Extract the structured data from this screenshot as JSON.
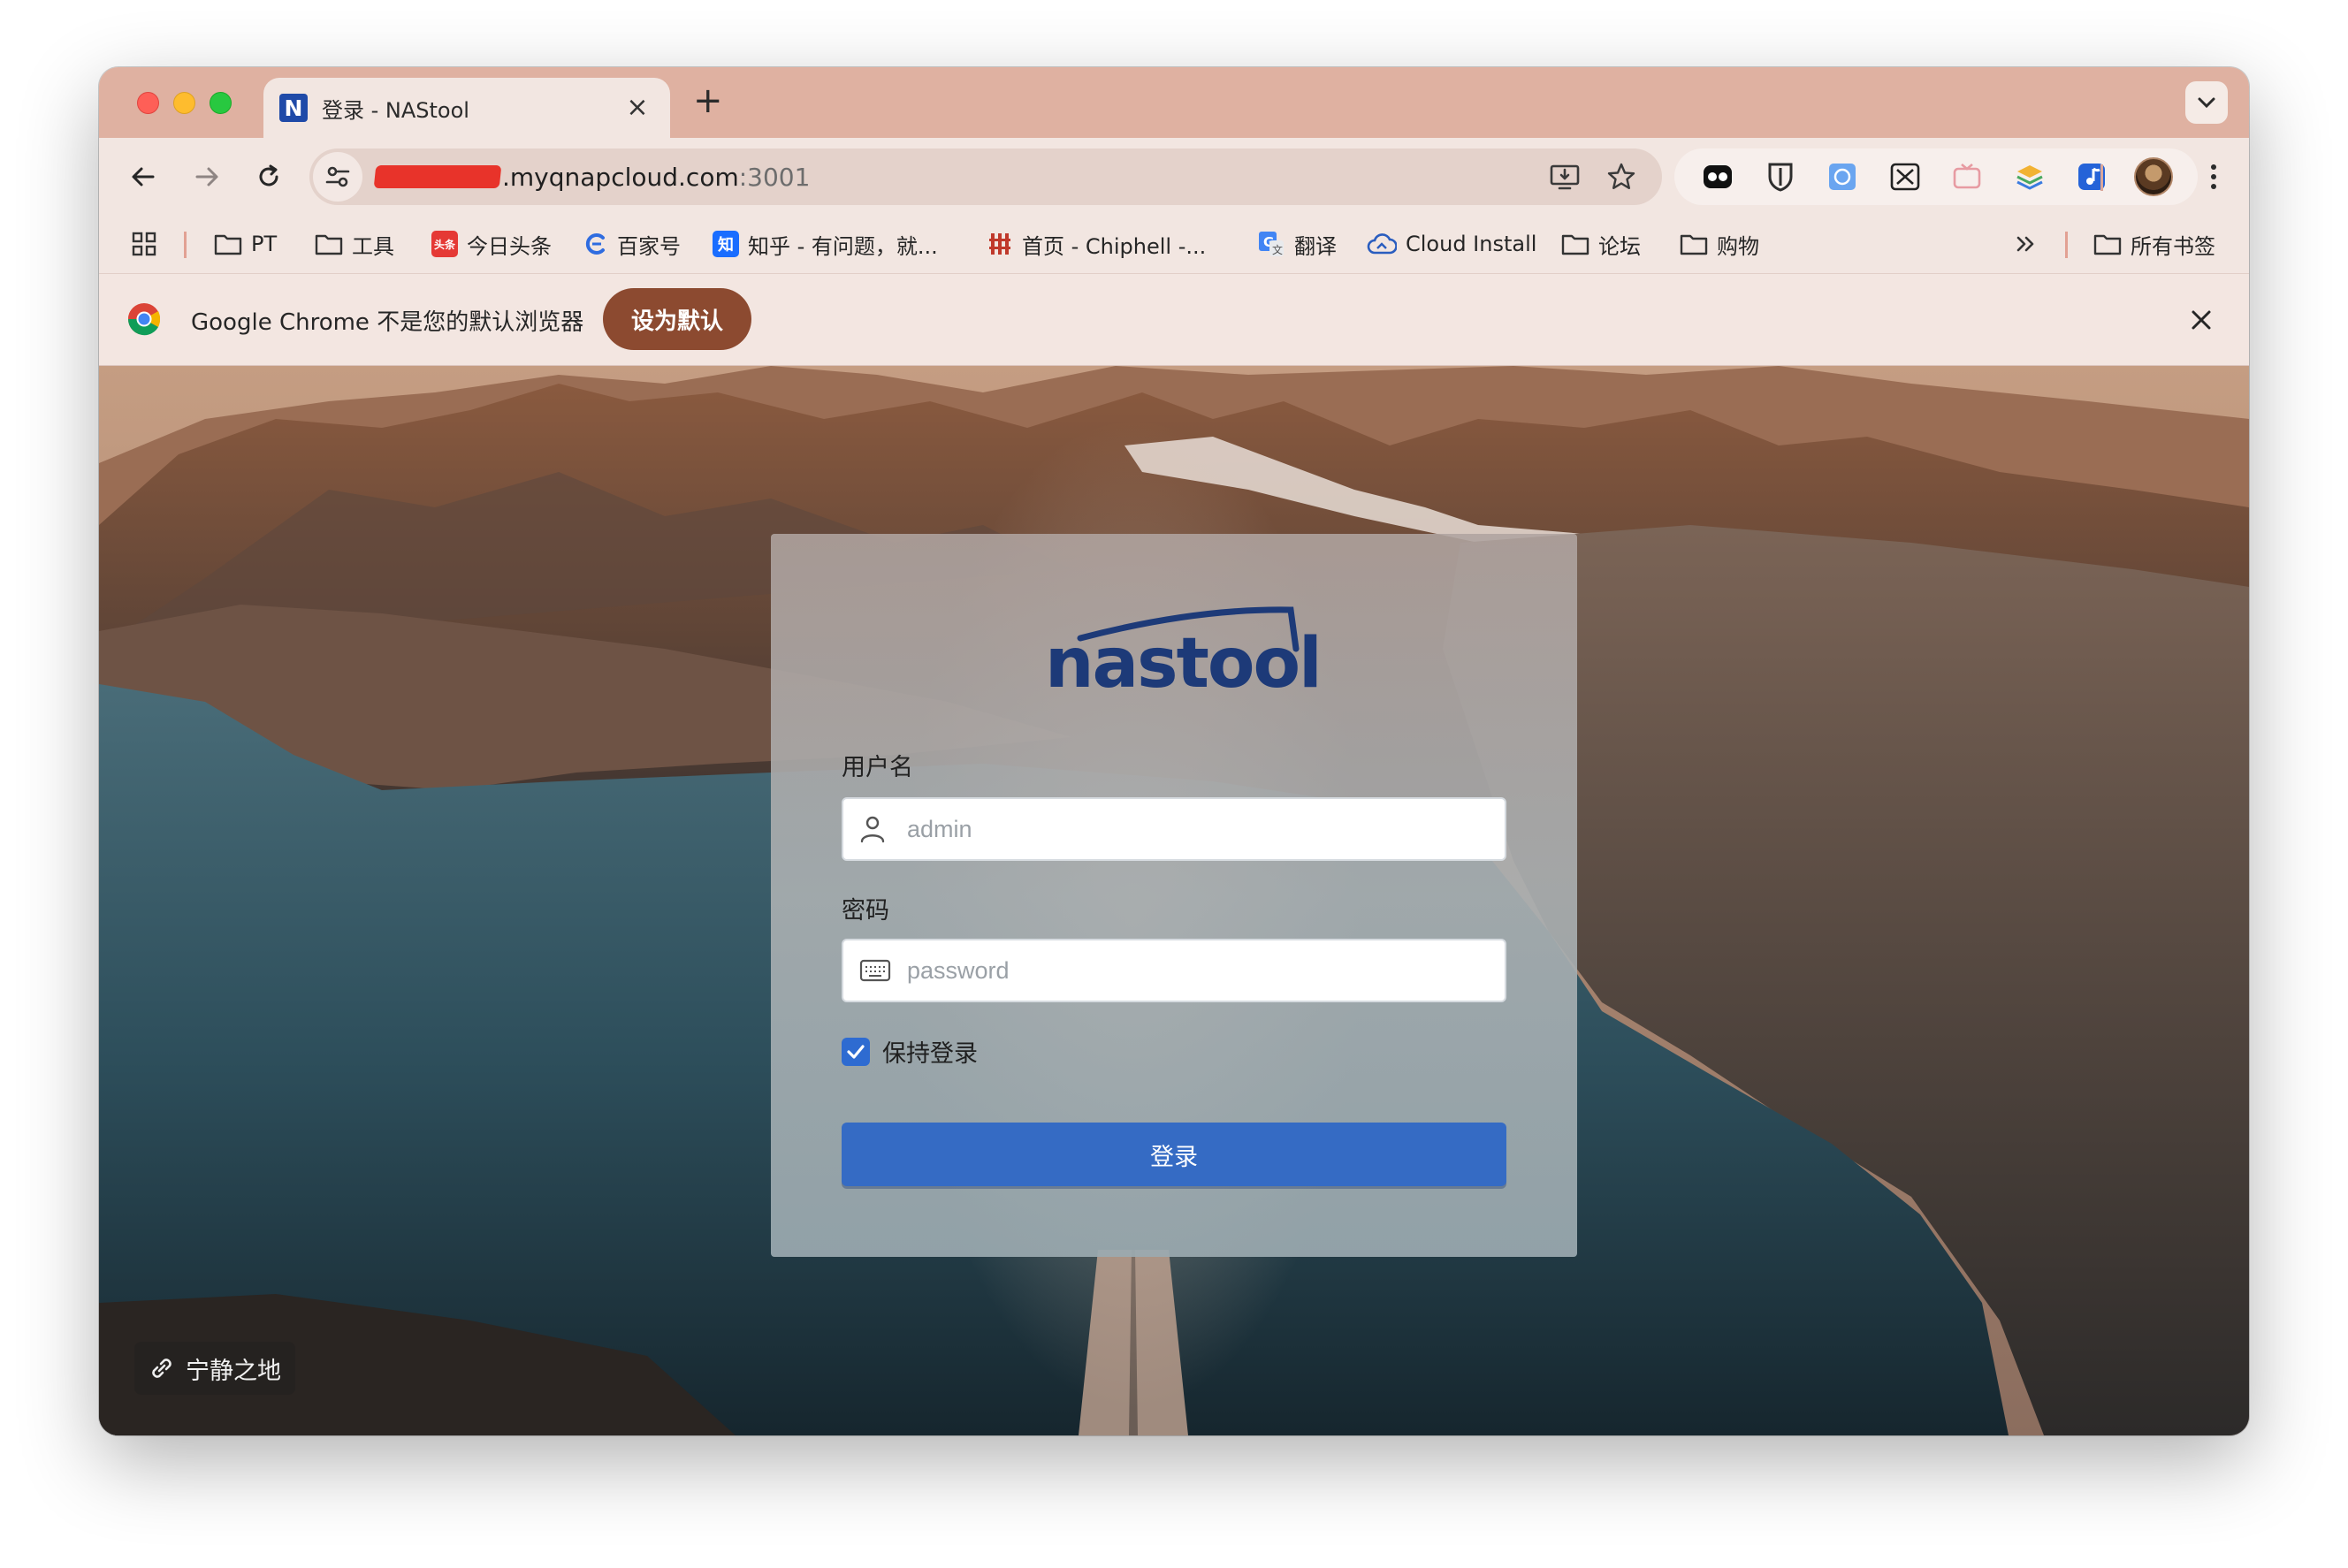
{
  "browser": {
    "tab": {
      "favicon_letter": "N",
      "title": "登录 - NAStool"
    },
    "address": {
      "host_visible": ".myqnapcloud.com",
      "port": ":3001"
    },
    "bookmarks": [
      {
        "label": "PT"
      },
      {
        "label": "工具"
      },
      {
        "label": "今日头条",
        "badge": "头条"
      },
      {
        "label": "百家号"
      },
      {
        "label": "知乎 - 有问题，就...",
        "badge": "知"
      },
      {
        "label": "首页 - Chiphell -..."
      },
      {
        "label": "翻译"
      },
      {
        "label": "Cloud Install"
      },
      {
        "label": "论坛"
      },
      {
        "label": "购物"
      },
      {
        "label": "所有书签"
      }
    ],
    "infobar": {
      "message": "Google Chrome 不是您的默认浏览器",
      "button": "设为默认"
    }
  },
  "login": {
    "logo_text": "nastool",
    "username_label": "用户名",
    "username_placeholder": "admin",
    "password_label": "密码",
    "password_placeholder": "password",
    "remember_label": "保持登录",
    "remember_checked": true,
    "submit_label": "登录"
  },
  "footer": {
    "credit": "宁静之地"
  },
  "colors": {
    "accent": "#356bc4",
    "tabstrip": "#dfb1a1",
    "infobar_button": "#8c4a30"
  }
}
